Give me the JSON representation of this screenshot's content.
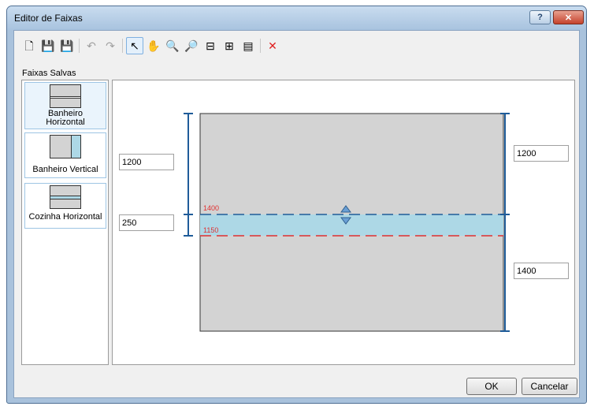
{
  "window": {
    "title": "Editor de Faixas",
    "help_label": "?",
    "close_label": "✕"
  },
  "toolbar": {
    "tools": [
      {
        "name": "new-icon",
        "glyph": "🗋",
        "enabled": true
      },
      {
        "name": "save-icon",
        "glyph": "💾",
        "enabled": true
      },
      {
        "name": "save-as-icon",
        "glyph": "💾",
        "enabled": false
      },
      {
        "name": "undo-icon",
        "glyph": "↶",
        "enabled": false
      },
      {
        "name": "redo-icon",
        "glyph": "↷",
        "enabled": false
      },
      {
        "name": "pointer-icon",
        "glyph": "↖",
        "enabled": true,
        "active": true
      },
      {
        "name": "pan-icon",
        "glyph": "✋",
        "enabled": true
      },
      {
        "name": "zoom-extents-icon",
        "glyph": "🔍",
        "enabled": true
      },
      {
        "name": "zoom-icon",
        "glyph": "🔎",
        "enabled": true
      },
      {
        "name": "horizontal-split-icon",
        "glyph": "⊟",
        "enabled": true
      },
      {
        "name": "vertical-split-icon",
        "glyph": "⊞",
        "enabled": true
      },
      {
        "name": "properties-icon",
        "glyph": "▤",
        "enabled": true
      },
      {
        "name": "delete-icon",
        "glyph": "✕",
        "enabled": true,
        "color": "#e02020"
      }
    ]
  },
  "sidebar": {
    "label": "Faixas Salvas",
    "items": [
      {
        "label": "Banheiro Horizontal",
        "line1": "Banheiro",
        "line2": "Horizontal",
        "type": "horizontal",
        "selected": true
      },
      {
        "label": "Banheiro Vertical",
        "type": "vertical",
        "selected": false
      },
      {
        "label": "Cozinha Horizontal",
        "type": "horizontal",
        "selected": false
      }
    ]
  },
  "editor": {
    "left_top_value": "1200",
    "left_bottom_value": "250",
    "right_top_value": "1200",
    "right_bottom_value": "1400",
    "stripe_top_label": "1400",
    "stripe_bottom_label": "1150"
  },
  "buttons": {
    "ok": "OK",
    "cancel": "Cancelar"
  },
  "colors": {
    "panel_gray": "#d3d3d3",
    "stripe_blue": "#add8e6",
    "dimension_blue": "#1f5c99",
    "red_line": "#e03030"
  }
}
